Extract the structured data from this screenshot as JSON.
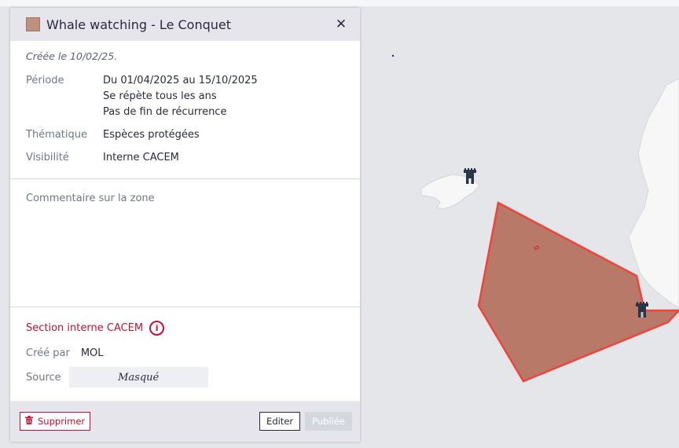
{
  "zone": {
    "title": "Whale watching - Le Conquet",
    "created": "Créée le 10/02/25.",
    "color": "#c0907f"
  },
  "details": [
    {
      "label": "Période",
      "lines": [
        "Du 01/04/2025 au 15/10/2025",
        "Se répète tous les ans",
        "Pas de fin de récurrence"
      ]
    },
    {
      "label": "Thématique",
      "lines": [
        "Espèces protégées"
      ]
    },
    {
      "label": "Visibilité",
      "lines": [
        "Interne CACEM"
      ]
    }
  ],
  "comment": {
    "placeholder": "Commentaire sur la zone"
  },
  "internal": {
    "title": "Section interne CACEM",
    "info_icon": "i",
    "created_by_label": "Créé par",
    "created_by_value": "MOL",
    "source_label": "Source",
    "source_value": "Masqué"
  },
  "footer": {
    "delete_label": "Supprimer",
    "edit_label": "Editer",
    "publish_label": "Publiée"
  },
  "icons": {
    "close": "✕",
    "trash": "🗑"
  },
  "colors": {
    "accent_red": "#c80f32",
    "zone_fill": "#b5705c",
    "zone_stroke": "#f0433a",
    "sea": "#e4e6ea",
    "land": "#f7f7f7"
  }
}
